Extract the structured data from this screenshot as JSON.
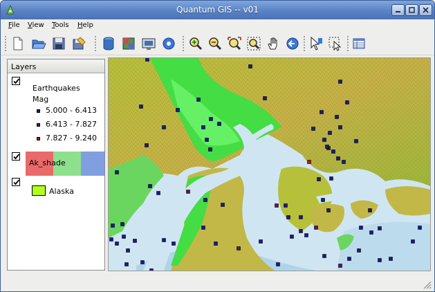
{
  "window": {
    "title": "Quantum GIS -- v01",
    "buttons": [
      "minimize",
      "maximize",
      "close"
    ]
  },
  "menu": {
    "items": [
      {
        "label": "File",
        "mnemonic_index": 0
      },
      {
        "label": "View",
        "mnemonic_index": 0
      },
      {
        "label": "Tools",
        "mnemonic_index": 0
      },
      {
        "label": "Help",
        "mnemonic_index": 0
      }
    ]
  },
  "toolbar": {
    "icons": [
      "new-project-icon",
      "open-project-icon",
      "save-project-icon",
      "save-as-icon",
      "add-vector-layer-icon",
      "add-raster-layer-icon",
      "add-postgis-layer-icon",
      "capture-point-icon",
      "zoom-in-icon",
      "zoom-out-icon",
      "zoom-full-icon",
      "zoom-selection-icon",
      "pan-icon",
      "zoom-last-icon",
      "identify-icon",
      "select-icon",
      "attribute-table-icon"
    ]
  },
  "layers": {
    "header": "Layers",
    "earthquakes": {
      "name": "Earthquakes",
      "field": "Mag",
      "classes": [
        {
          "label": "5.000 - 6.413",
          "color": "#1a1a8c"
        },
        {
          "label": "6.413 - 7.827",
          "color": "#5a1a5a"
        },
        {
          "label": "7.827 - 9.240",
          "color": "#b01a1a"
        }
      ],
      "checked": true
    },
    "ak_shade": {
      "name": "Ak_shade",
      "colors": [
        "#e86a6a",
        "#8ee08e",
        "#7f9fe0"
      ],
      "checked": true
    },
    "alaska": {
      "name": "Alaska",
      "color": "#b2ff22",
      "checked": true
    }
  },
  "colors": {
    "title_bar": "#5a82c4",
    "sea": "#cfe6f2",
    "lowland": "#44dd44",
    "highland": "#c8b048",
    "point_class_1": "#1a1a8c",
    "point_class_2": "#5a1a5a",
    "point_class_3": "#b01a1a"
  }
}
